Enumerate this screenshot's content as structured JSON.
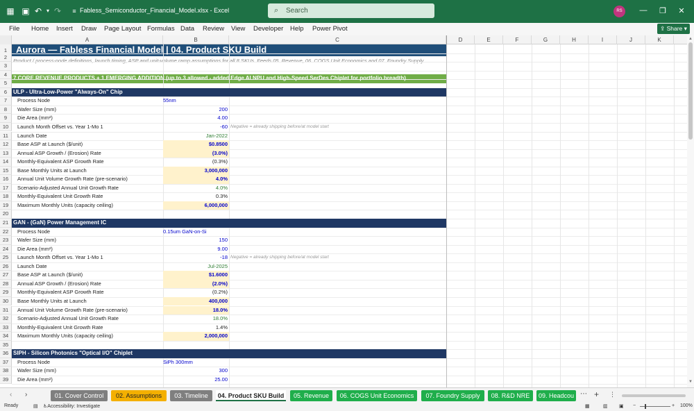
{
  "app": {
    "filename": "Fabless_Semiconductor_Financial_Model.xlsx",
    "appname": "Excel",
    "separator": "-",
    "search_placeholder": "Search",
    "avatar_initials": "RS",
    "share_label": "Share"
  },
  "menu": [
    "File",
    "Home",
    "Insert",
    "Draw",
    "Page Layout",
    "Formulas",
    "Data",
    "Review",
    "View",
    "Developer",
    "Help",
    "Power Pivot"
  ],
  "columns": [
    "A",
    "B",
    "C",
    "D",
    "E",
    "F",
    "G",
    "H",
    "I",
    "J",
    "K"
  ],
  "rows": [
    "1",
    "2",
    "3",
    "4",
    "5",
    "6",
    "7",
    "8",
    "9",
    "10",
    "11",
    "12",
    "13",
    "14",
    "15",
    "16",
    "17",
    "18",
    "19",
    "20",
    "21",
    "22",
    "23",
    "24",
    "25",
    "26",
    "27",
    "28",
    "29",
    "30",
    "31",
    "32",
    "33",
    "34",
    "35",
    "36",
    "37",
    "38",
    "39"
  ],
  "sheet": {
    "title": "Aurora — Fabless Financial Model  |  04. Product SKU Build",
    "subtitle": "Product / process-node definitions, launch timing, ASP and unit-volume ramp assumptions for all 8 SKUs. Feeds 05. Revenue, 06. COGS Unit Economics and 07. Foundry Supply",
    "banner": "7 CORE REVENUE PRODUCTS + 1 EMERGING ADDITION  (up to 3 allowed - added Edge AI NPU and High-Speed SerDes Chiplet for portfolio breadth)",
    "note": "Negative = already shipping before/at model start",
    "sections": [
      {
        "header": "ULP - Ultra-Low-Power \"Always-On\" Chip",
        "labels": [
          "Process Node",
          "Wafer Size (mm)",
          "Die Area (mm²)",
          "Launch Month Offset vs. Year 1-Mo 1",
          "Launch Date",
          "Base ASP at Launch ($/unit)",
          "Annual ASP Growth / (Erosion) Rate",
          "Monthly-Equivalent ASP Growth Rate",
          "Base Monthly Units at Launch",
          "Annual Unit Volume Growth Rate (pre-scenario)",
          "Scenario-Adjusted Annual Unit Growth Rate",
          "Monthly-Equivalent Unit Growth Rate",
          "Maximum Monthly Units (capacity ceiling)"
        ],
        "values": [
          "55nm",
          "200",
          "4.00",
          "-60",
          "Jan-2022",
          "$0.8500",
          "(3.0%)",
          "(0.3%)",
          "3,000,000",
          "4.0%",
          "4.0%",
          "0.3%",
          "6,000,000"
        ]
      },
      {
        "header": "GAN - (GaN) Power Management IC",
        "labels": [
          "Process Node",
          "Wafer Size (mm)",
          "Die Area (mm²)",
          "Launch Month Offset vs. Year 1-Mo 1",
          "Launch Date",
          "Base ASP at Launch ($/unit)",
          "Annual ASP Growth / (Erosion) Rate",
          "Monthly-Equivalent ASP Growth Rate",
          "Base Monthly Units at Launch",
          "Annual Unit Volume Growth Rate (pre-scenario)",
          "Scenario-Adjusted Annual Unit Growth Rate",
          "Monthly-Equivalent Unit Growth Rate",
          "Maximum Monthly Units (capacity ceiling)"
        ],
        "values": [
          "0.15um GaN-on-Si",
          "150",
          "9.00",
          "-18",
          "Jul-2025",
          "$1.6000",
          "(2.0%)",
          "(0.2%)",
          "400,000",
          "18.0%",
          "18.0%",
          "1.4%",
          "2,000,000"
        ]
      },
      {
        "header": "SIPH - Silicon Photonics \"Optical I/O\" Chiplet",
        "labels": [
          "Process Node",
          "Wafer Size (mm)",
          "Die Area (mm²)"
        ],
        "values": [
          "SiPh 300mm",
          "300",
          "25.00"
        ]
      }
    ]
  },
  "tabs": [
    "01. Cover Control",
    "02. Assumptions",
    "03. Timeline",
    "04. Product SKU Build",
    "05. Revenue",
    "06. COGS Unit Economics",
    "07. Foundry Supply",
    "08. R&D NRE",
    "09. Headcou"
  ],
  "tab_colors": [
    "#7f7f7f",
    "#f4b000",
    "#7f7f7f",
    "#ffffff",
    "#1fae4b",
    "#1fae4b",
    "#1fae4b",
    "#1fae4b",
    "#1fae4b"
  ],
  "status": {
    "ready": "Ready",
    "accessibility": "Accessibility: Investigate",
    "zoom": "100%"
  }
}
